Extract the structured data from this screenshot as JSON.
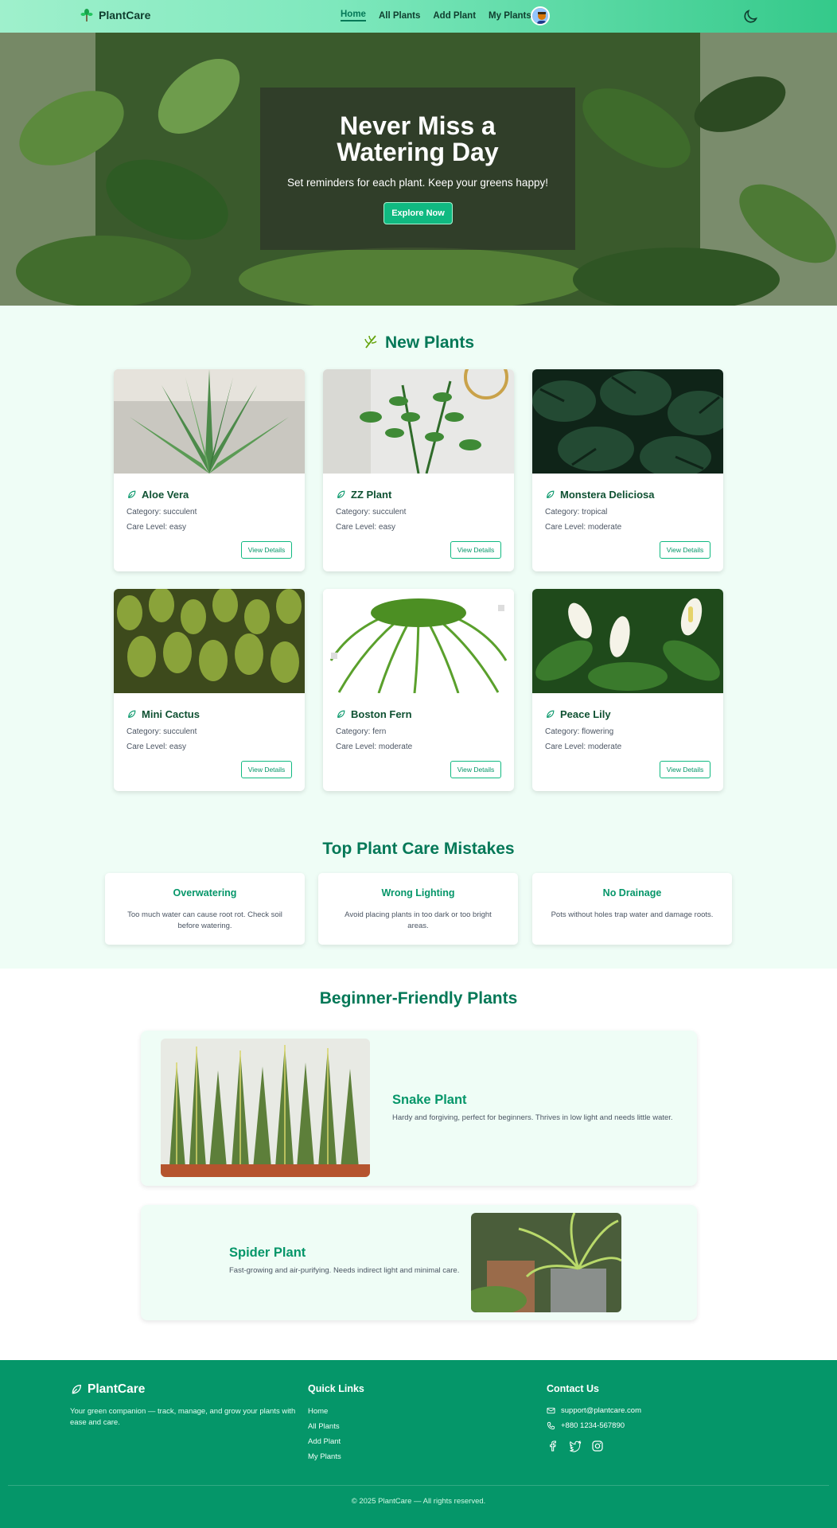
{
  "nav": {
    "brand": "PlantCare",
    "links": [
      {
        "label": "Home",
        "active": true
      },
      {
        "label": "All Plants",
        "active": false
      },
      {
        "label": "Add Plant",
        "active": false
      },
      {
        "label": "My Plants",
        "active": false
      }
    ],
    "icons": [
      "plant-logo-icon",
      "user-avatar",
      "moon-icon"
    ]
  },
  "hero": {
    "title_line1": "Never Miss a",
    "title_line2": "Watering Day",
    "subtitle": "Set reminders for each plant. Keep your greens happy!",
    "cta": "Explore Now"
  },
  "new_plants": {
    "title": "New Plants",
    "category_prefix": "Category:",
    "care_prefix": "Care Level:",
    "button": "View Details",
    "items": [
      {
        "name": "Aloe Vera",
        "category": "succulent",
        "care": "easy"
      },
      {
        "name": "ZZ Plant",
        "category": "succulent",
        "care": "easy"
      },
      {
        "name": "Monstera Deliciosa",
        "category": "tropical",
        "care": "moderate"
      },
      {
        "name": "Mini Cactus",
        "category": "succulent",
        "care": "easy"
      },
      {
        "name": "Boston Fern",
        "category": "fern",
        "care": "moderate"
      },
      {
        "name": "Peace Lily",
        "category": "flowering",
        "care": "moderate"
      }
    ]
  },
  "mistakes": {
    "title": "Top Plant Care Mistakes",
    "items": [
      {
        "title": "Overwatering",
        "text": "Too much water can cause root rot. Check soil before watering."
      },
      {
        "title": "Wrong Lighting",
        "text": "Avoid placing plants in too dark or too bright areas."
      },
      {
        "title": "No Drainage",
        "text": "Pots without holes trap water and damage roots."
      }
    ]
  },
  "beginner": {
    "title": "Beginner-Friendly Plants",
    "items": [
      {
        "name": "Snake Plant",
        "desc": "Hardy and forgiving, perfect for beginners. Thrives in low light and needs little water."
      },
      {
        "name": "Spider Plant",
        "desc": "Fast-growing and air-purifying. Needs indirect light and minimal care."
      }
    ]
  },
  "footer": {
    "brand": "PlantCare",
    "desc": "Your green companion — track, manage, and grow your plants with ease and care.",
    "quick_links_title": "Quick Links",
    "quick_links": [
      "Home",
      "All Plants",
      "Add Plant",
      "My Plants"
    ],
    "contact_title": "Contact Us",
    "email": "support@plantcare.com",
    "phone": "+880 1234-567890",
    "social": [
      "facebook-icon",
      "twitter-icon",
      "instagram-icon"
    ],
    "copyright": "© 2025 PlantCare — All rights reserved."
  },
  "colors": {
    "primary": "#059669",
    "accent": "#10b981",
    "light_bg": "#effdf6",
    "heading": "#047857"
  }
}
